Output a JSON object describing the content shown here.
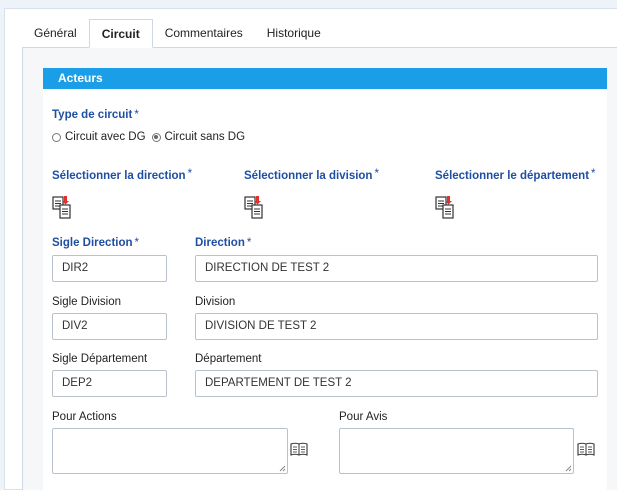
{
  "tabs": [
    {
      "label": "Général"
    },
    {
      "label": "Circuit"
    },
    {
      "label": "Commentaires"
    },
    {
      "label": "Historique"
    }
  ],
  "section": {
    "title": "Acteurs"
  },
  "circuit_type": {
    "label": "Type de circuit",
    "required_mark": "*",
    "options": [
      {
        "label": "Circuit avec DG",
        "checked": false
      },
      {
        "label": "Circuit sans DG",
        "checked": true
      }
    ]
  },
  "selectors": {
    "direction": {
      "label": "Sélectionner la direction",
      "required_mark": "*"
    },
    "division": {
      "label": "Sélectionner la division",
      "required_mark": "*"
    },
    "departement": {
      "label": "Sélectionner le département",
      "required_mark": "*"
    }
  },
  "fields": {
    "sigle_direction": {
      "label": "Sigle Direction",
      "required_mark": "*",
      "value": "DIR2"
    },
    "direction": {
      "label": "Direction",
      "required_mark": "*",
      "value": "DIRECTION DE TEST 2"
    },
    "sigle_division": {
      "label": "Sigle Division",
      "value": "DIV2"
    },
    "division": {
      "label": "Division",
      "value": "DIVISION DE TEST 2"
    },
    "sigle_departement": {
      "label": "Sigle Département",
      "value": "DEP2"
    },
    "departement": {
      "label": "Département",
      "value": "DEPARTEMENT DE TEST 2"
    },
    "pour_actions": {
      "label": "Pour Actions",
      "value": ""
    },
    "pour_avis": {
      "label": "Pour Avis",
      "value": ""
    }
  },
  "icons": {
    "select": "select-list-icon",
    "book": "book-icon"
  },
  "colors": {
    "header_bg": "#1a9ee8",
    "label_blue": "#1f4fa2",
    "icon_red": "#e03030"
  }
}
